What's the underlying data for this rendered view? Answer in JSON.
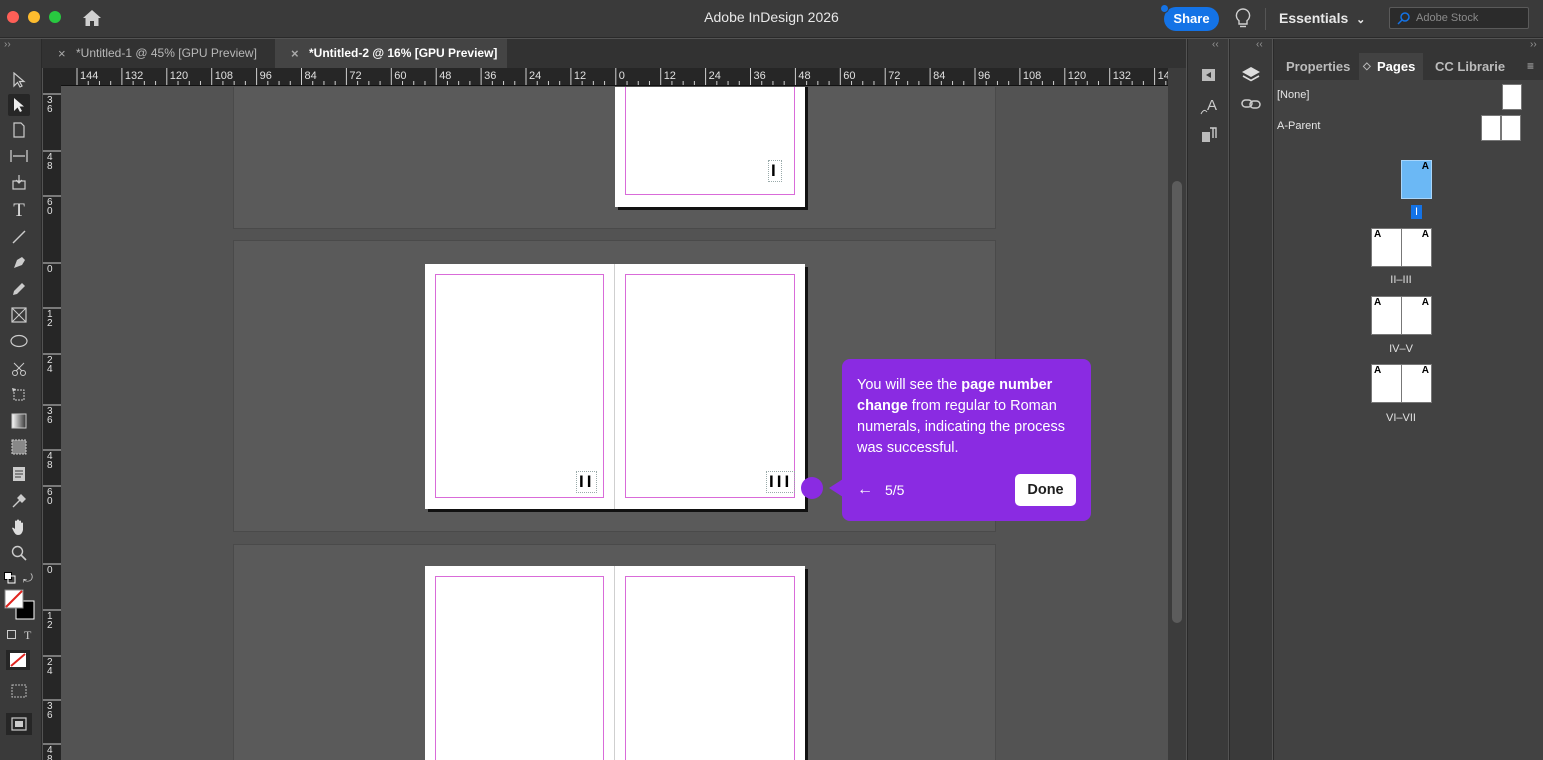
{
  "window": {
    "title": "Adobe InDesign 2026",
    "share_label": "Share",
    "workspace_label": "Essentials",
    "search_placeholder": "Adobe Stock"
  },
  "tabs": [
    {
      "label": "*Untitled-1 @ 45% [GPU Preview]",
      "active": false
    },
    {
      "label": "*Untitled-2 @ 16% [GPU Preview]",
      "active": true
    }
  ],
  "ruler": {
    "top_labels": [
      "144",
      "132",
      "120",
      "108",
      "96",
      "84",
      "72",
      "60",
      "48",
      "36",
      "24",
      "12",
      "0",
      "12",
      "24",
      "36",
      "48",
      "60",
      "72",
      "84",
      "96",
      "108",
      "120",
      "132",
      "14"
    ],
    "left_labels": [
      "3\n6",
      "4\n8",
      "6\n0",
      "0",
      "1\n2",
      "2\n4",
      "3\n6",
      "4\n8",
      "6\n0",
      "0",
      "1\n2",
      "2\n4",
      "3\n6",
      "4\n8"
    ]
  },
  "canvas": {
    "page_numbers": {
      "p1": "I",
      "p2": "II",
      "p3": "III"
    }
  },
  "panel": {
    "tabs": [
      "Properties",
      "Pages",
      "CC Librarie"
    ],
    "active_tab": "Pages",
    "masters": [
      {
        "label": "[None]"
      },
      {
        "label": "A-Parent"
      }
    ],
    "master_letter": "A",
    "pages": [
      {
        "label": "I",
        "selected": true
      },
      {
        "label": "II–III"
      },
      {
        "label": "IV–V"
      },
      {
        "label": "VI–VII"
      }
    ]
  },
  "tooltip": {
    "text_1": "You will see the ",
    "bold": "page number change",
    "text_2": " from regular to Roman numerals, indicating the process was successful.",
    "step": "5/5",
    "back_icon": "←",
    "done_label": "Done"
  },
  "colors": {
    "accent": "#8a2be2",
    "share": "#1473e6",
    "margin_guide": "#d96bd9",
    "page_selected": "#6bb8f5"
  }
}
